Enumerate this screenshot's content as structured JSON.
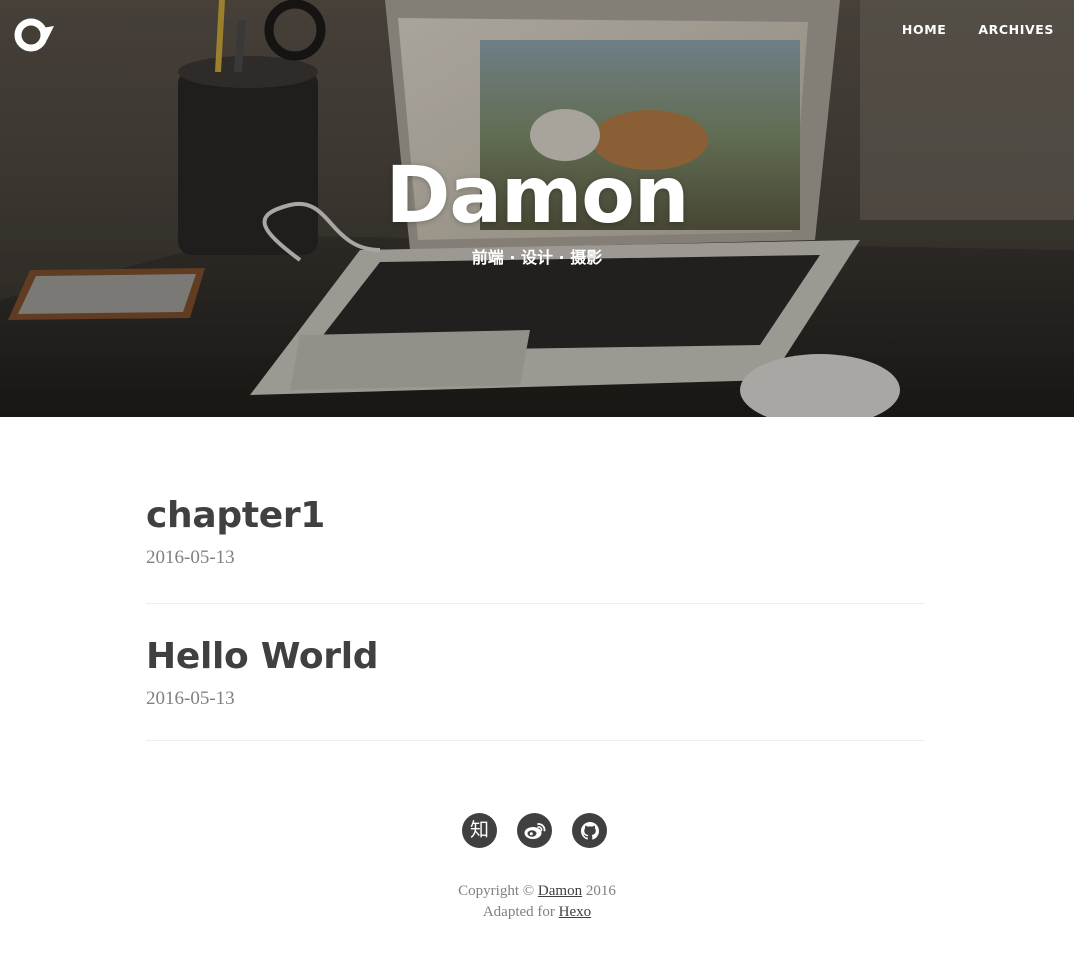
{
  "header": {
    "title": "Damon",
    "subtitle": "前端 · 设计 · 摄影",
    "nav": [
      {
        "label": "HOME"
      },
      {
        "label": "ARCHIVES"
      }
    ]
  },
  "posts": [
    {
      "title": "chapter1",
      "date": "2016-05-13"
    },
    {
      "title": "Hello World",
      "date": "2016-05-13"
    }
  ],
  "footer": {
    "social": [
      {
        "icon": "zhihu-icon",
        "glyph": "知"
      },
      {
        "icon": "weibo-icon"
      },
      {
        "icon": "github-icon"
      }
    ],
    "copyright_prefix": "Copyright © ",
    "author": "Damon",
    "year": " 2016",
    "adapted_prefix": "Adapted for ",
    "adapted_link": "Hexo"
  },
  "colors": {
    "text": "#404040",
    "muted": "#808080",
    "divider": "#eeeeee",
    "hero_text": "#ffffff"
  }
}
